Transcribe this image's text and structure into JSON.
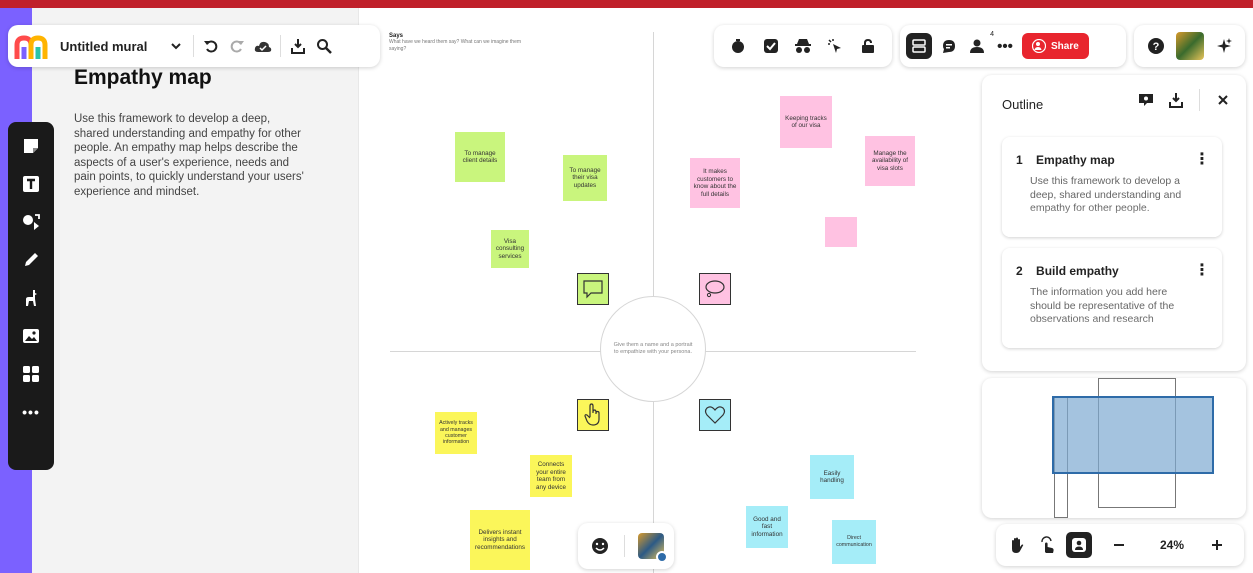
{
  "app": {
    "mural_title": "Untitled mural",
    "accent_color": "#c0202a",
    "brand_stripe_color": "#7b61ff"
  },
  "description": {
    "title": "Empathy map",
    "text": "Use this framework to develop a deep, shared understanding and empathy for other people. An empathy map helps describe the aspects of a user's experience, needs and pain points, to quickly understand your users' experience and mindset."
  },
  "canvas": {
    "says_title": "Says",
    "says_subtitle": "What have we heard them say? What can we imagine them saying?",
    "center_text": "Give them a name and a portrait to empathize with your persona.",
    "stickies": [
      {
        "text": "To manage client details",
        "color": "green"
      },
      {
        "text": "To manage their visa updates",
        "color": "green"
      },
      {
        "text": "Visa consulting services",
        "color": "green"
      },
      {
        "text": "It makes customers to know about the full details",
        "color": "pink"
      },
      {
        "text": "Keeping tracks of our visa",
        "color": "pink"
      },
      {
        "text": "Manage the availability of visa slots",
        "color": "pink"
      },
      {
        "text": "",
        "color": "pink"
      },
      {
        "text": "Actively tracks and manages customer information",
        "color": "yellow"
      },
      {
        "text": "Connects your entire team from any device",
        "color": "yellow"
      },
      {
        "text": "Delivers instant insights and recommendations",
        "color": "yellow"
      },
      {
        "text": "Easily handling",
        "color": "blue"
      },
      {
        "text": "Good and fast information",
        "color": "blue"
      },
      {
        "text": "Direct communication",
        "color": "blue"
      }
    ]
  },
  "header": {
    "share_label": "Share",
    "notifications_count": "4"
  },
  "outline": {
    "title": "Outline",
    "items": [
      {
        "number": "1",
        "title": "Empathy map",
        "body": "Use this framework to develop a deep, shared understanding and empathy for other people."
      },
      {
        "number": "2",
        "title": "Build empathy",
        "body": "The information you add here should be representative of the observations and research"
      }
    ]
  },
  "zoom": {
    "level": "24%"
  },
  "icons": {
    "logo": "mural-logo-icon",
    "undo": "undo-icon",
    "redo": "redo-icon",
    "cloud": "cloud-sync-icon",
    "export": "export-icon",
    "search": "search-icon"
  }
}
